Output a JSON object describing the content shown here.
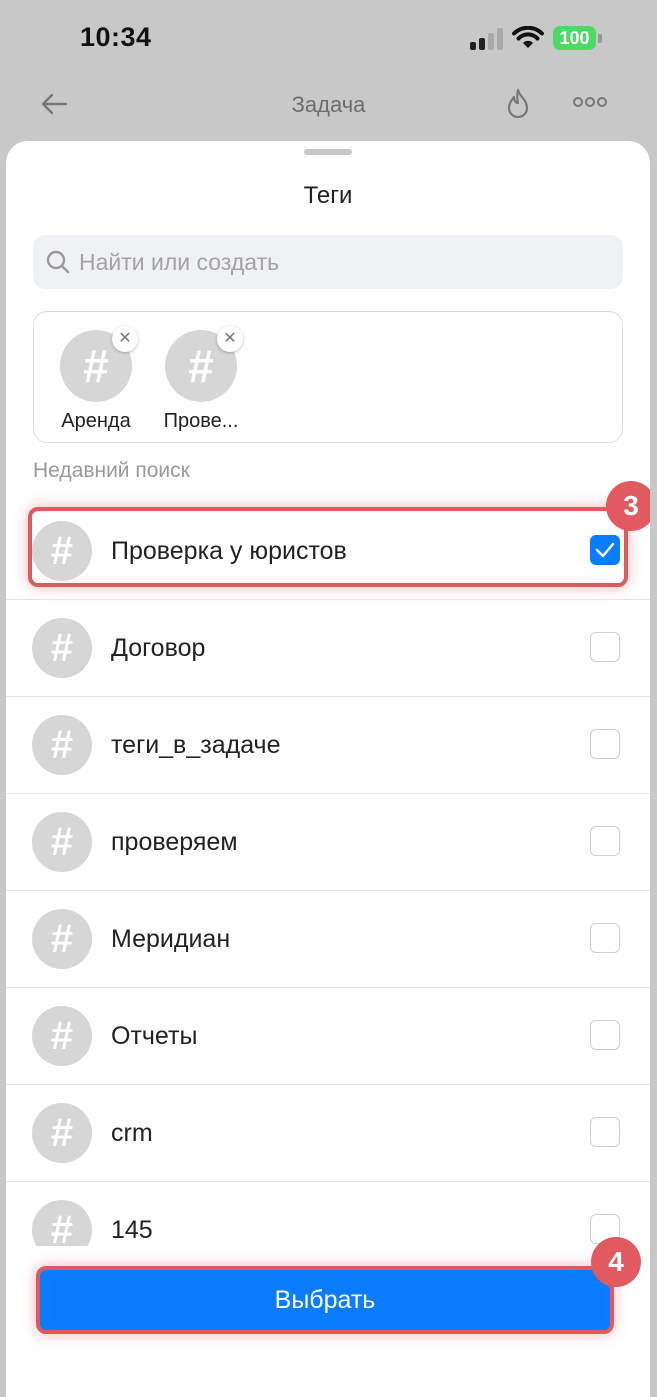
{
  "status_bar": {
    "time": "10:34",
    "battery": "100"
  },
  "nav": {
    "title": "Задача"
  },
  "sheet": {
    "title": "Теги",
    "search_placeholder": "Найти или создать",
    "selected_tags": [
      {
        "label": "Аренда"
      },
      {
        "label": "Прове..."
      }
    ],
    "section_label": "Недавний поиск",
    "tags": [
      {
        "label": "Проверка у юристов",
        "checked": true
      },
      {
        "label": "Договор",
        "checked": false
      },
      {
        "label": "теги_в_задаче",
        "checked": false
      },
      {
        "label": "проверяем",
        "checked": false
      },
      {
        "label": "Меридиан",
        "checked": false
      },
      {
        "label": "Отчеты",
        "checked": false
      },
      {
        "label": "crm",
        "checked": false
      },
      {
        "label": "145",
        "checked": false
      }
    ],
    "select_button": "Выбрать"
  },
  "annotations": {
    "step_3": "3",
    "step_4": "4"
  },
  "colors": {
    "accent": "#0a7cff",
    "highlight": "#e05a5f",
    "battery": "#4cd964"
  }
}
